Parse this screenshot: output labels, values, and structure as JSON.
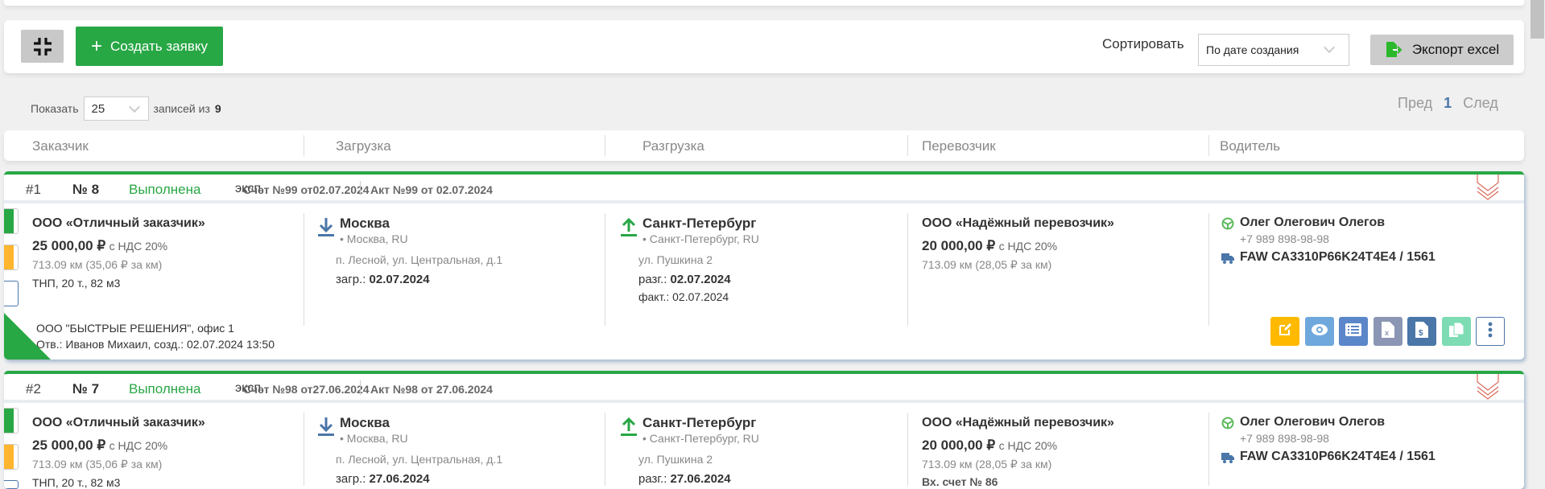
{
  "toolbar": {
    "create_label": "Создать заявку",
    "sort_label": "Сортировать",
    "sort_value": "По дате создания",
    "export_label": "Экспорт excel"
  },
  "pager": {
    "show_label": "Показать",
    "per_page": "25",
    "records_of_label": "записей из",
    "total": "9",
    "prev": "Пред",
    "current": "1",
    "next": "След"
  },
  "columns": [
    "Заказчик",
    "Загрузка",
    "Разгрузка",
    "Перевозчик",
    "Водитель"
  ],
  "colors": {
    "accent": "#28a745",
    "blue": "#4a76a8",
    "orange": "#ffb52e"
  },
  "orders": [
    {
      "index": "#1",
      "number": "№ 8",
      "status": "Выполнена",
      "type": "эксп.",
      "invoice": "Счет №99 от02.07.2024",
      "act": "Акт №99 от 02.07.2024",
      "customer": {
        "name": "ООО «Отличный заказчик»",
        "price": "25 000,00 ₽",
        "vat": "с НДС 20%",
        "distance": "713.09 км (35,06 ₽ за км)",
        "cargo": "ТНП, 20 т., 82 м3"
      },
      "loading": {
        "city": "Москва",
        "region": "• Москва, RU",
        "address": "п. Лесной, ул. Центральная, д.1",
        "date_label": "загр.:",
        "date": "02.07.2024"
      },
      "unloading": {
        "city": "Санкт-Петербург",
        "region": "• Санкт-Петербург, RU",
        "address": "ул. Пушкина 2",
        "date_label": "разг.:",
        "date": "02.07.2024",
        "fact": "факт.: 02.07.2024"
      },
      "carrier": {
        "name": "ООО «Надёжный перевозчик»",
        "price": "20 000,00 ₽",
        "vat": "с НДС 20%",
        "distance": "713.09 км (28,05 ₽ за км)",
        "extra": ""
      },
      "driver": {
        "name": "Олег Олегович Олегов",
        "phone": "+7 989 898-98-98",
        "vehicle": "FAW CA3310P66K24T4E4 / 1561"
      },
      "footer": {
        "company": "ООО \"БЫСТРЫЕ РЕШЕНИЯ\", офис 1",
        "responsible": "Отв.: Иванов Михаил, созд.: 02.07.2024 13:50"
      }
    },
    {
      "index": "#2",
      "number": "№ 7",
      "status": "Выполнена",
      "type": "эксп.",
      "invoice": "Счет №98 от27.06.2024",
      "act": "Акт №98 от 27.06.2024",
      "customer": {
        "name": "ООО «Отличный заказчик»",
        "price": "25 000,00 ₽",
        "vat": "с НДС 20%",
        "distance": "713.09 км (35,06 ₽ за км)",
        "cargo": "ТНП, 20 т., 82 м3"
      },
      "loading": {
        "city": "Москва",
        "region": "• Москва, RU",
        "address": "п. Лесной, ул. Центральная, д.1",
        "date_label": "загр.:",
        "date": "27.06.2024"
      },
      "unloading": {
        "city": "Санкт-Петербург",
        "region": "• Санкт-Петербург, RU",
        "address": "ул. Пушкина 2",
        "date_label": "разг.:",
        "date": "27.06.2024",
        "fact": ""
      },
      "carrier": {
        "name": "ООО «Надёжный перевозчик»",
        "price": "20 000,00 ₽",
        "vat": "с НДС 20%",
        "distance": "713.09 км (28,05 ₽ за км)",
        "extra": "Вх. счет № 86"
      },
      "driver": {
        "name": "Олег Олегович Олегов",
        "phone": "+7 989 898-98-98",
        "vehicle": "FAW CA3310P66K24T4E4 / 1561"
      },
      "footer": {
        "company": "",
        "responsible": ""
      }
    }
  ]
}
